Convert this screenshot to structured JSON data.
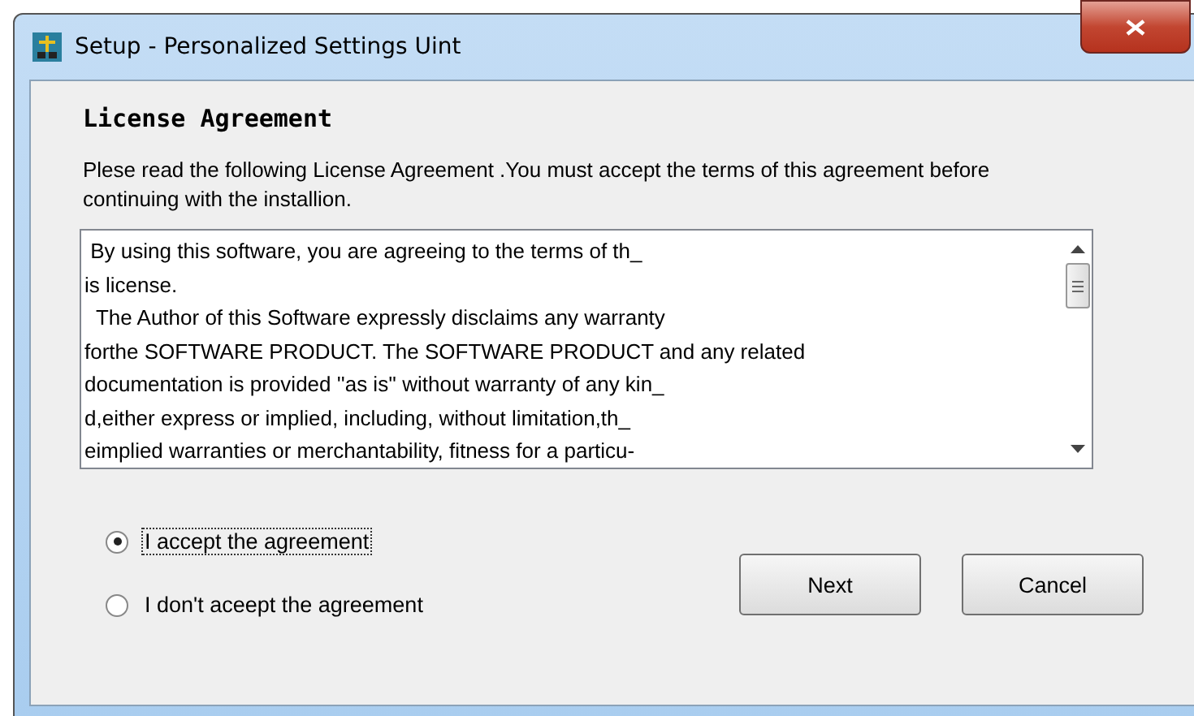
{
  "window": {
    "title": "Setup - Personalized Settings Uint"
  },
  "heading": "License Agreement",
  "intro": "Plese read the following License Agreement .You must accept the terms of this agreement before continuing with the installion.",
  "license_lines": [
    " By using this software, you are agreeing to the terms of th_",
    "is license.",
    "  The Author of this Software expressly disclaims any warranty",
    "forthe SOFTWARE PRODUCT. The SOFTWARE PRODUCT and any related",
    "documentation is provided ''as is'' without warranty of any kin_",
    "d,either express or implied, including, without limitation,th_",
    "eimplied warranties or merchantability, fitness for a particu-"
  ],
  "options": [
    {
      "label": "I accept the agreement",
      "selected": true
    },
    {
      "label": "I don't aceept the agreement",
      "selected": false
    }
  ],
  "buttons": [
    "Next",
    "Cancel"
  ]
}
